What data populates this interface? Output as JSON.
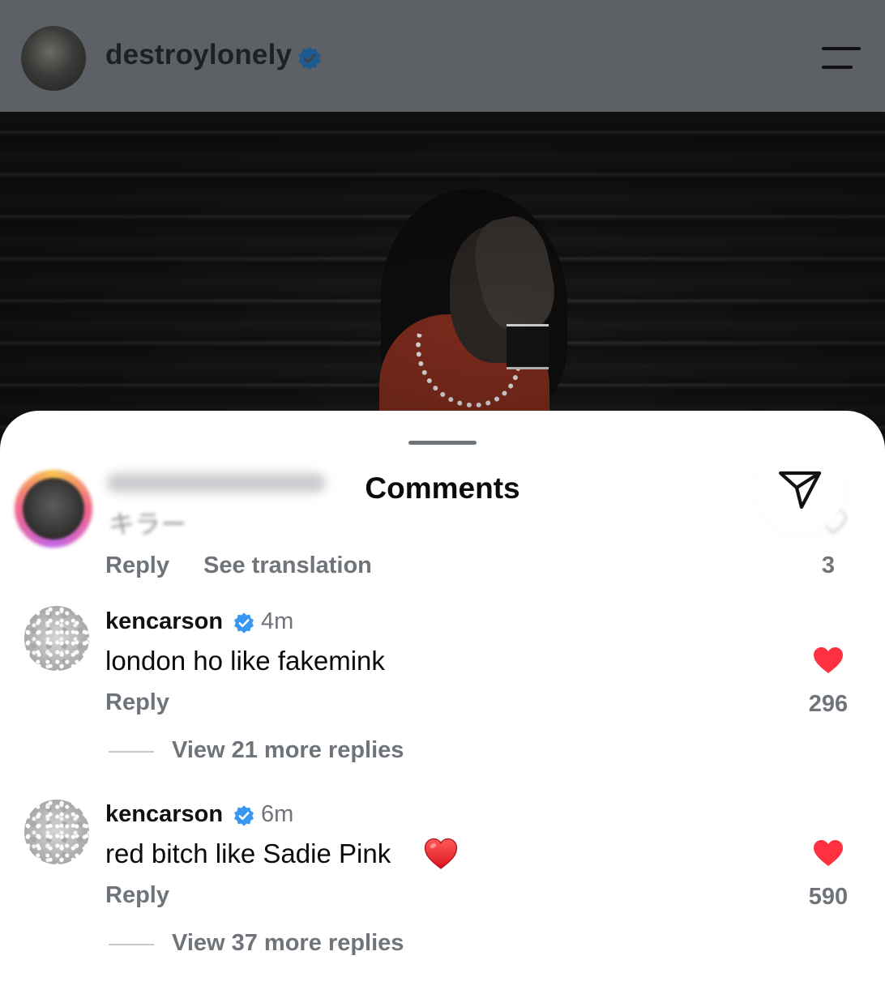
{
  "header": {
    "username": "destroylonely",
    "verified": true
  },
  "sheet": {
    "title": "Comments"
  },
  "comments": [
    {
      "username_hidden": true,
      "text": "キラー",
      "reply_label": "Reply",
      "translate_label": "See translation",
      "likes": "3"
    },
    {
      "username": "kencarson",
      "verified": true,
      "time": "4m",
      "text": "london ho like fakemink",
      "reply_label": "Reply",
      "likes": "296",
      "liked": true,
      "view_replies": "View 21 more replies"
    },
    {
      "username": "kencarson",
      "verified": true,
      "time": "6m",
      "text": "red bitch like Sadie Pink",
      "emoji": "heart-emoji",
      "reply_label": "Reply",
      "likes": "590",
      "liked": true,
      "view_replies": "View 37 more replies"
    }
  ],
  "colors": {
    "header_bg": "#5d6064",
    "verified_blue": "#3897f0",
    "like_red": "#ff3040",
    "secondary_text": "#6f747a"
  }
}
